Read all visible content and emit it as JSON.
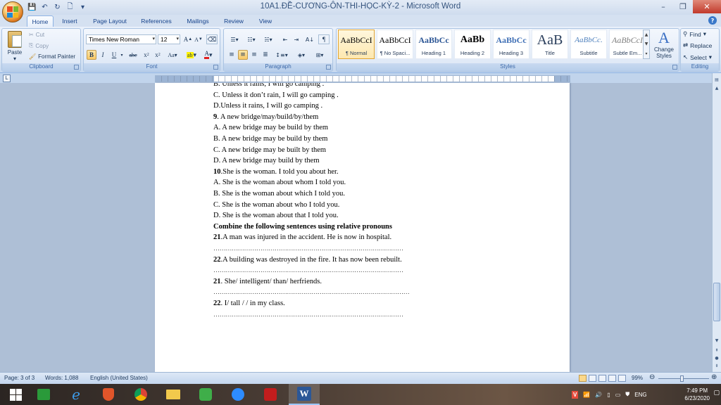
{
  "window": {
    "title": "10A1.ĐỀ-CƯƠNG-ÔN-THI-HỌC-KỲ-2 - Microsoft Word",
    "minimize": "–",
    "restore": "❐",
    "close": "✕"
  },
  "tabs": [
    "Home",
    "Insert",
    "Page Layout",
    "References",
    "Mailings",
    "Review",
    "View"
  ],
  "ribbon": {
    "clipboard": {
      "label": "Clipboard",
      "paste": "Paste",
      "cut": "Cut",
      "copy": "Copy",
      "format_painter": "Format Painter"
    },
    "font": {
      "label": "Font",
      "family": "Times New Roman",
      "size": "12"
    },
    "paragraph": {
      "label": "Paragraph"
    },
    "styles": {
      "label": "Styles",
      "items": [
        {
          "sample": "AaBbCcI",
          "name": "¶ Normal"
        },
        {
          "sample": "AaBbCcI",
          "name": "¶ No Spaci..."
        },
        {
          "sample": "AaBbCc",
          "name": "Heading 1"
        },
        {
          "sample": "AaBb",
          "name": "Heading 2"
        },
        {
          "sample": "AaBbCc",
          "name": "Heading 3"
        },
        {
          "sample": "AaB",
          "name": "Title"
        },
        {
          "sample": "AaBbCc.",
          "name": "Subtitle"
        },
        {
          "sample": "AaBbCcI",
          "name": "Subtle Em..."
        }
      ],
      "change_styles": "Change Styles"
    },
    "editing": {
      "label": "Editing",
      "find": "Find",
      "replace": "Replace",
      "select": "Select"
    }
  },
  "document": {
    "lines": [
      {
        "text": "B. Unless it rains, I will go camping .",
        "bold": false
      },
      {
        "text": "C. Unless it don’t rain, I will go camping .",
        "bold": false
      },
      {
        "text": " D.Unless it rains, I will go camping .",
        "bold": false
      },
      {
        "num": "9",
        "text": ". A new bridge/may/build/by/them",
        "bold": false
      },
      {
        "text": "A. A new bridge may be build by them",
        "bold": false
      },
      {
        "text": "B. A new bridge may be build by them",
        "bold": false
      },
      {
        "text": "C. A new bridge may be built by them",
        "bold": false
      },
      {
        "text": "D. A new bridge may build by them",
        "bold": false
      },
      {
        "num": "10",
        "text": ".She is the woman. I told you about her.",
        "bold": false
      },
      {
        "text": "A. She is the woman about whom I told you.",
        "bold": false
      },
      {
        "text": "B. She is the woman about which I told you.",
        "bold": false
      },
      {
        "text": "C. She is the woman about who I told you.",
        "bold": false
      },
      {
        "text": "D. She is the woman about that I told you.",
        "bold": false
      },
      {
        "text": "Combine the following sentences using relative pronouns",
        "bold": true
      },
      {
        "num": "21",
        "text": ".A man was injured in the accident. He is now in hospital.",
        "bold": false
      },
      {
        "text": "…………………………………………………………………………………",
        "bold": false
      },
      {
        "num": "22",
        "text": ".A building was destroyed in the fire.  It has now been rebuilt.",
        "bold": false
      },
      {
        "text": "…………………………………………………………………………………",
        "bold": false
      },
      {
        "num": "21",
        "text": ".  She/ intelligent/ than/ herfriends.",
        "bold": false
      },
      {
        "text": "……………………………………………………………………………………",
        "bold": false
      },
      {
        "num": "22",
        "text": ". I/ tall  / / in my class.",
        "bold": false
      },
      {
        "text": "…………………………………………………………………………………",
        "bold": false
      }
    ]
  },
  "statusbar": {
    "page": "Page: 3 of 3",
    "words": "Words: 1,088",
    "language": "English (United States)",
    "zoom": "99%"
  },
  "taskbar": {
    "language": "ENG",
    "time": "7:49 PM",
    "date": "6/23/2020"
  }
}
